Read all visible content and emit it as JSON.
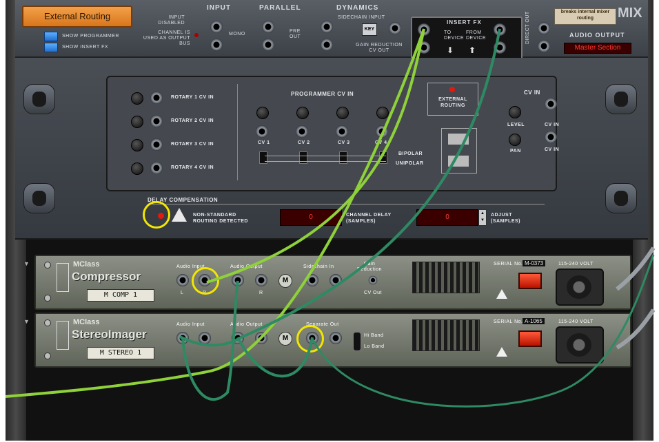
{
  "mixer": {
    "routing_button": "External Routing",
    "show_programmer": "SHOW PROGRAMMER",
    "show_insert_fx": "SHOW INSERT FX",
    "input_disabled": "INPUT DISABLED",
    "channel_used": "CHANNEL IS USED AS OUTPUT BUS",
    "input_header": "INPUT",
    "mono": "MONO",
    "parallel_header": "PARALLEL",
    "pre_out": "PRE OUT",
    "dynamics_header": "DYNAMICS",
    "sidechain_input": "SIDECHAIN INPUT",
    "key": "KEY",
    "gain_reduction_cv": "GAIN REDUCTION CV OUT",
    "insert_fx": "INSERT FX",
    "to_device": "TO DEVICE",
    "from_device": "FROM DEVICE",
    "direct_out": "DIRECT OUT",
    "badge": "breaks internal mixer routing",
    "mix_logo": "MIX",
    "audio_output": "AUDIO OUTPUT",
    "audio_output_value": "Master Section",
    "L": "L",
    "R": "R"
  },
  "cv_panel": {
    "rotary_labels": [
      "ROTARY 1  CV IN",
      "ROTARY 2  CV IN",
      "ROTARY 3  CV IN",
      "ROTARY 4  CV IN"
    ],
    "programmer_cv_in": "PROGRAMMER  CV IN",
    "cv_labels": [
      "CV 1",
      "CV 2",
      "CV 3",
      "CV 4"
    ],
    "bipolar": "BIPOLAR",
    "unipolar": "UNIPOLAR",
    "external_routing": "EXTERNAL ROUTING",
    "cv_in": "CV IN",
    "level": "LEVEL",
    "pan": "PAN",
    "cv_in_small": "CV IN"
  },
  "delay": {
    "title": "DELAY COMPENSATION",
    "warning": "NON-STANDARD ROUTING DETECTED",
    "channel_delay_value": "0",
    "channel_delay_label": "CHANNEL DELAY (SAMPLES)",
    "adjust_value": "0",
    "adjust_label": "ADJUST (SAMPLES)"
  },
  "devices": [
    {
      "brand": "MClass",
      "name": "Compressor",
      "plate": "M COMP 1",
      "audio_input": "Audio Input",
      "audio_output": "Audio Output",
      "third_section": "Sidechain In",
      "gain_reduction": "Gain Reduction",
      "cv_out": "CV Out",
      "serial_label": "SERIAL No.",
      "serial": "M-0373",
      "voltage": "115-240 VOLT"
    },
    {
      "brand": "MClass",
      "name": "StereoImager",
      "plate": "M STEREO 1",
      "audio_input": "Audio Input",
      "audio_output": "Audio Output",
      "third_section": "Separate Out",
      "mode_top": "Hi Band",
      "mode_bottom": "Lo Band",
      "serial_label": "SERIAL No.",
      "serial": "A-1065",
      "voltage": "115-240 VOLT"
    }
  ],
  "colors": {
    "orange": "#e68a2e",
    "highlight": "#f2e600",
    "cable_light": "#8fd13a",
    "cable_dark": "#2e8a63",
    "led_red": "#ff3b30"
  }
}
